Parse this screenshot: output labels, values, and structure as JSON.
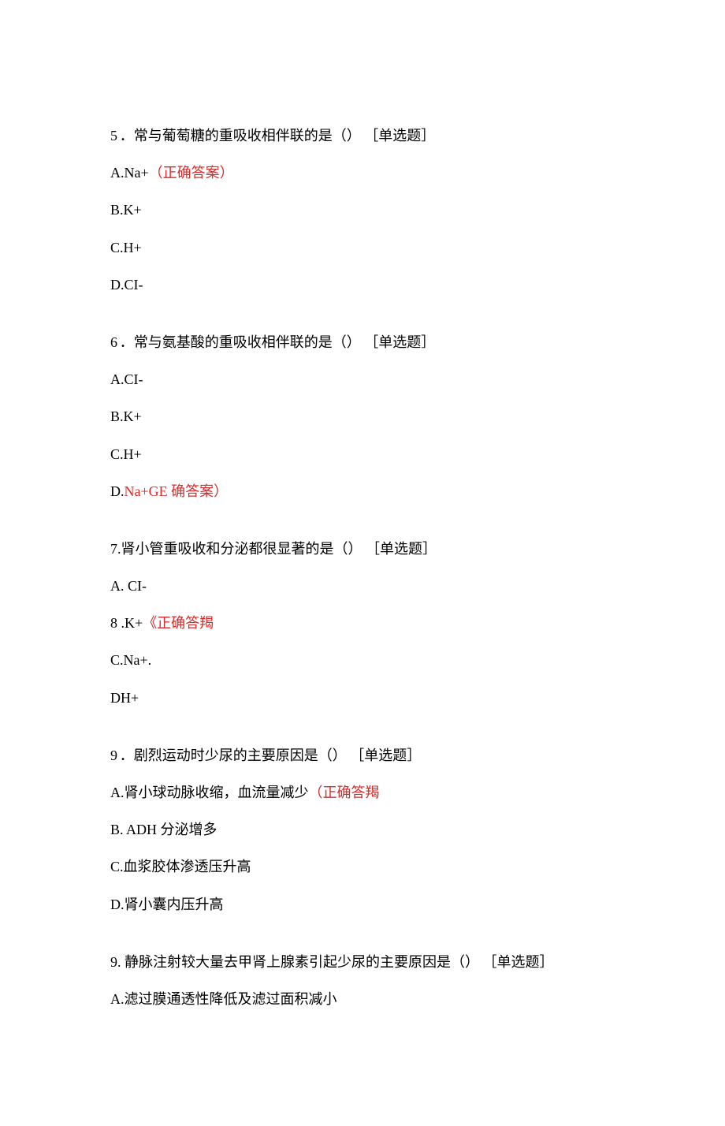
{
  "q5": {
    "number": "5",
    "dot": "．",
    "text": "常与葡萄糖的重吸收相伴联的是（） ［单选题］",
    "a_prefix": "A.Na+",
    "a_highlight": "（正确答案）",
    "b": "B.K+",
    "c": "C.H+",
    "d": "D.CI-"
  },
  "q6": {
    "number": "6",
    "dot": "．",
    "text": "常与氨基酸的重吸收相伴联的是（） ［单选题］",
    "a": "A.CI-",
    "b": "B.K+",
    "c": "C.H+",
    "d_prefix": "D.",
    "d_highlight": "Na+GE 确答案）"
  },
  "q7": {
    "text": "7.肾小管重吸收和分泌都很显著的是（） ［单选题］",
    "a": "A.   CI-",
    "b_prefix": "8  .K+",
    "b_highlight": "《正确答羯",
    "c": "C.Na+.",
    "d": "DH+"
  },
  "q8": {
    "number": "9",
    "dot": "．",
    "text": "剧烈运动时少尿的主要原因是（） ［单选题］",
    "a_prefix": "A.肾小球动脉收缩，血流量减少",
    "a_highlight": "（正确答羯",
    "b": "B.   ADH 分泌增多",
    "c": "C.血浆胶体渗透压升高",
    "d": "D.肾小囊内压升高"
  },
  "q9": {
    "text": "9. 静脉注射较大量去甲肾上腺素引起少尿的主要原因是（） ［单选题］",
    "a": "A.滤过膜通透性降低及滤过面积减小"
  }
}
